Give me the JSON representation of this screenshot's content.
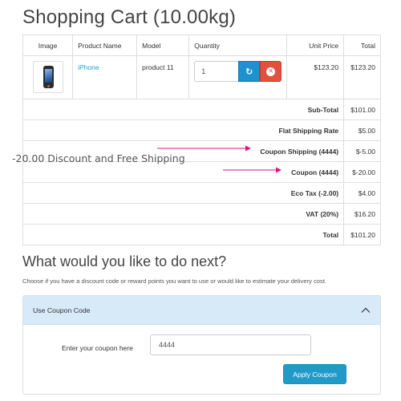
{
  "page": {
    "title": "Shopping Cart (10.00kg)"
  },
  "table": {
    "headers": {
      "image": "Image",
      "product_name": "Product Name",
      "model": "Model",
      "quantity": "Quantity",
      "unit_price": "Unit Price",
      "total": "Total"
    },
    "item": {
      "product_image_icon": "iphone-icon",
      "name": "iPhone",
      "model": "product 11",
      "quantity": "1",
      "unit_price": "$123.20",
      "total": "$123.20"
    },
    "totals": [
      {
        "label": "Sub-Total",
        "value": "$101.00"
      },
      {
        "label": "Flat Shipping Rate",
        "value": "$5.00"
      },
      {
        "label": "Coupon Shipping (4444)",
        "value": "$-5.00"
      },
      {
        "label": "Coupon (4444)",
        "value": "$-20.00"
      },
      {
        "label": "Eco Tax (-2.00)",
        "value": "$4.00"
      },
      {
        "label": "VAT (20%)",
        "value": "$16.20"
      },
      {
        "label": "Total",
        "value": "$101.20"
      }
    ]
  },
  "annotation": {
    "text": "-20.00 Discount and Free Shipping",
    "color": "#e0147f"
  },
  "next": {
    "title": "What would you like to do next?",
    "description": "Choose if you have a discount code or reward points you want to use or would like to estimate your delivery cost."
  },
  "coupon_panel": {
    "heading": "Use Coupon Code",
    "label": "Enter your coupon here",
    "value": "4444",
    "apply_label": "Apply Coupon"
  },
  "colors": {
    "link": "#23a1d1",
    "refresh_button": "#1e91cf",
    "remove_button": "#e3503e",
    "panel_heading": "#d6eaf8",
    "apply_button": "#229ac8"
  },
  "icons": {
    "refresh": "refresh-icon",
    "remove": "remove-circle-icon",
    "collapse": "chevron-up-icon"
  }
}
